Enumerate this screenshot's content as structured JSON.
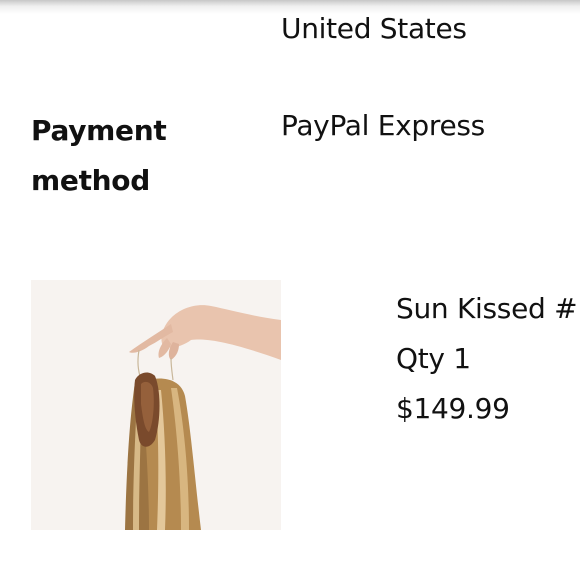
{
  "shipping": {
    "country": "United States"
  },
  "payment": {
    "label": "Payment method",
    "value": "PayPal Express"
  },
  "item": {
    "image_alt": "hair extension product photo",
    "name": "Sun Kissed #",
    "qty": "Qty 1",
    "price": "$149.99"
  }
}
